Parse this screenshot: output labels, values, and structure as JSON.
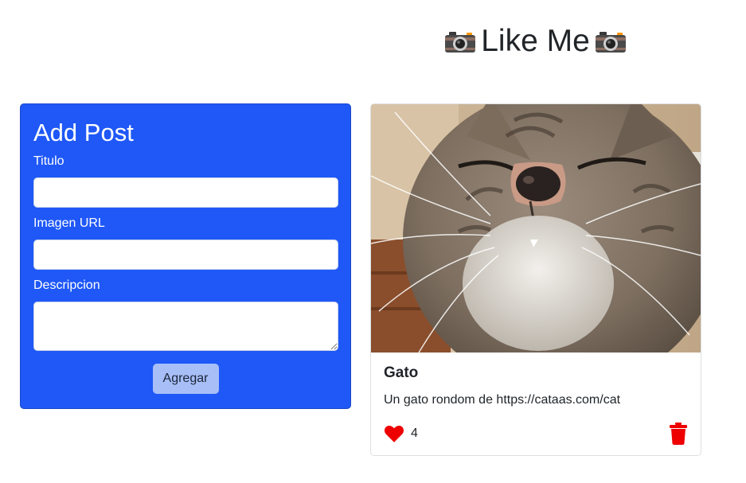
{
  "header": {
    "title": "Like Me",
    "icon": "camera-icon"
  },
  "form": {
    "title": "Add Post",
    "title_label": "Titulo",
    "title_value": "",
    "image_label": "Imagen URL",
    "image_value": "",
    "description_label": "Descripcion",
    "description_value": "",
    "submit_label": "Agregar",
    "accent_color": "#1f58f7"
  },
  "posts": [
    {
      "title": "Gato",
      "description": "Un gato rondom de https://cataas.com/cat",
      "likes": "4",
      "like_icon": "heart-icon",
      "delete_icon": "trash-icon",
      "like_color": "#ee0000"
    }
  ]
}
